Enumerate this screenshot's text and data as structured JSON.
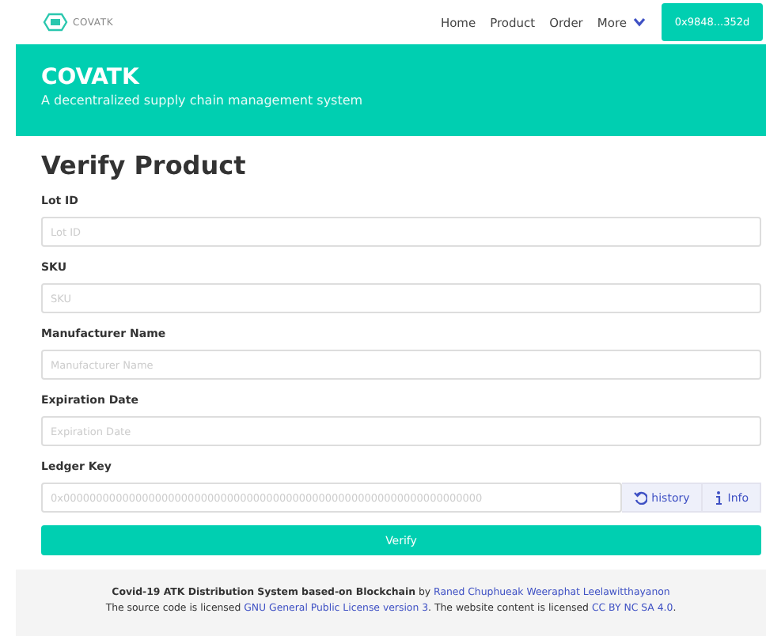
{
  "navbar": {
    "brand": "COVATK",
    "links": [
      {
        "label": "Home"
      },
      {
        "label": "Product"
      },
      {
        "label": "Order"
      },
      {
        "label": "More",
        "dropdown": true
      }
    ],
    "account": "0x9848...352d"
  },
  "hero": {
    "title": "COVATK",
    "subtitle": "A decentralized supply chain management system"
  },
  "form": {
    "title": "Verify Product",
    "fields": [
      {
        "label": "Lot ID",
        "placeholder": "Lot ID"
      },
      {
        "label": "SKU",
        "placeholder": "SKU"
      },
      {
        "label": "Manufacturer Name",
        "placeholder": "Manufacturer Name"
      },
      {
        "label": "Expiration Date",
        "placeholder": "Expiration Date"
      },
      {
        "label": "Ledger Key",
        "placeholder": "0x0000000000000000000000000000000000000000000000000000000000000000",
        "addons": [
          {
            "kind": "history",
            "label": "history"
          },
          {
            "kind": "info",
            "label": "Info"
          }
        ]
      }
    ],
    "submit": "Verify"
  },
  "footer": {
    "project": "Covid-19 ATK Distribution System based-on Blockchain",
    "by": "by",
    "authors": "Raned Chuphueak Weeraphat Leelawitthayanon",
    "license_pre": "The source code is licensed",
    "code_license": "GNU General Public License version 3",
    "license_mid": ". The website content is licensed",
    "content_license": "CC BY NC SA 4.0",
    "license_end": "."
  }
}
